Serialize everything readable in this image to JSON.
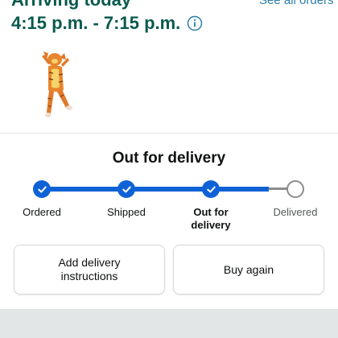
{
  "header": {
    "arriving_title": "Arriving today",
    "see_all_orders": "See all orders",
    "arrival_window": "4:15 p.m. - 7:15 p.m.",
    "info_icon": "info-icon"
  },
  "product": {
    "image_icon": "costume-onesie-image"
  },
  "tracking": {
    "status": "Out for delivery",
    "steps": [
      {
        "label": "Ordered",
        "state": "complete"
      },
      {
        "label": "Shipped",
        "state": "complete"
      },
      {
        "label": "Out for delivery",
        "state": "current"
      },
      {
        "label": "Delivered",
        "state": "pending"
      }
    ],
    "progress_color": "#0f62d6",
    "pending_color": "#8c8c8c"
  },
  "actions": {
    "add_delivery_instructions": "Add delivery instructions",
    "buy_again": "Buy again"
  },
  "colors": {
    "heading_green": "#0a5a4c",
    "link_blue": "#2a7fa8"
  }
}
